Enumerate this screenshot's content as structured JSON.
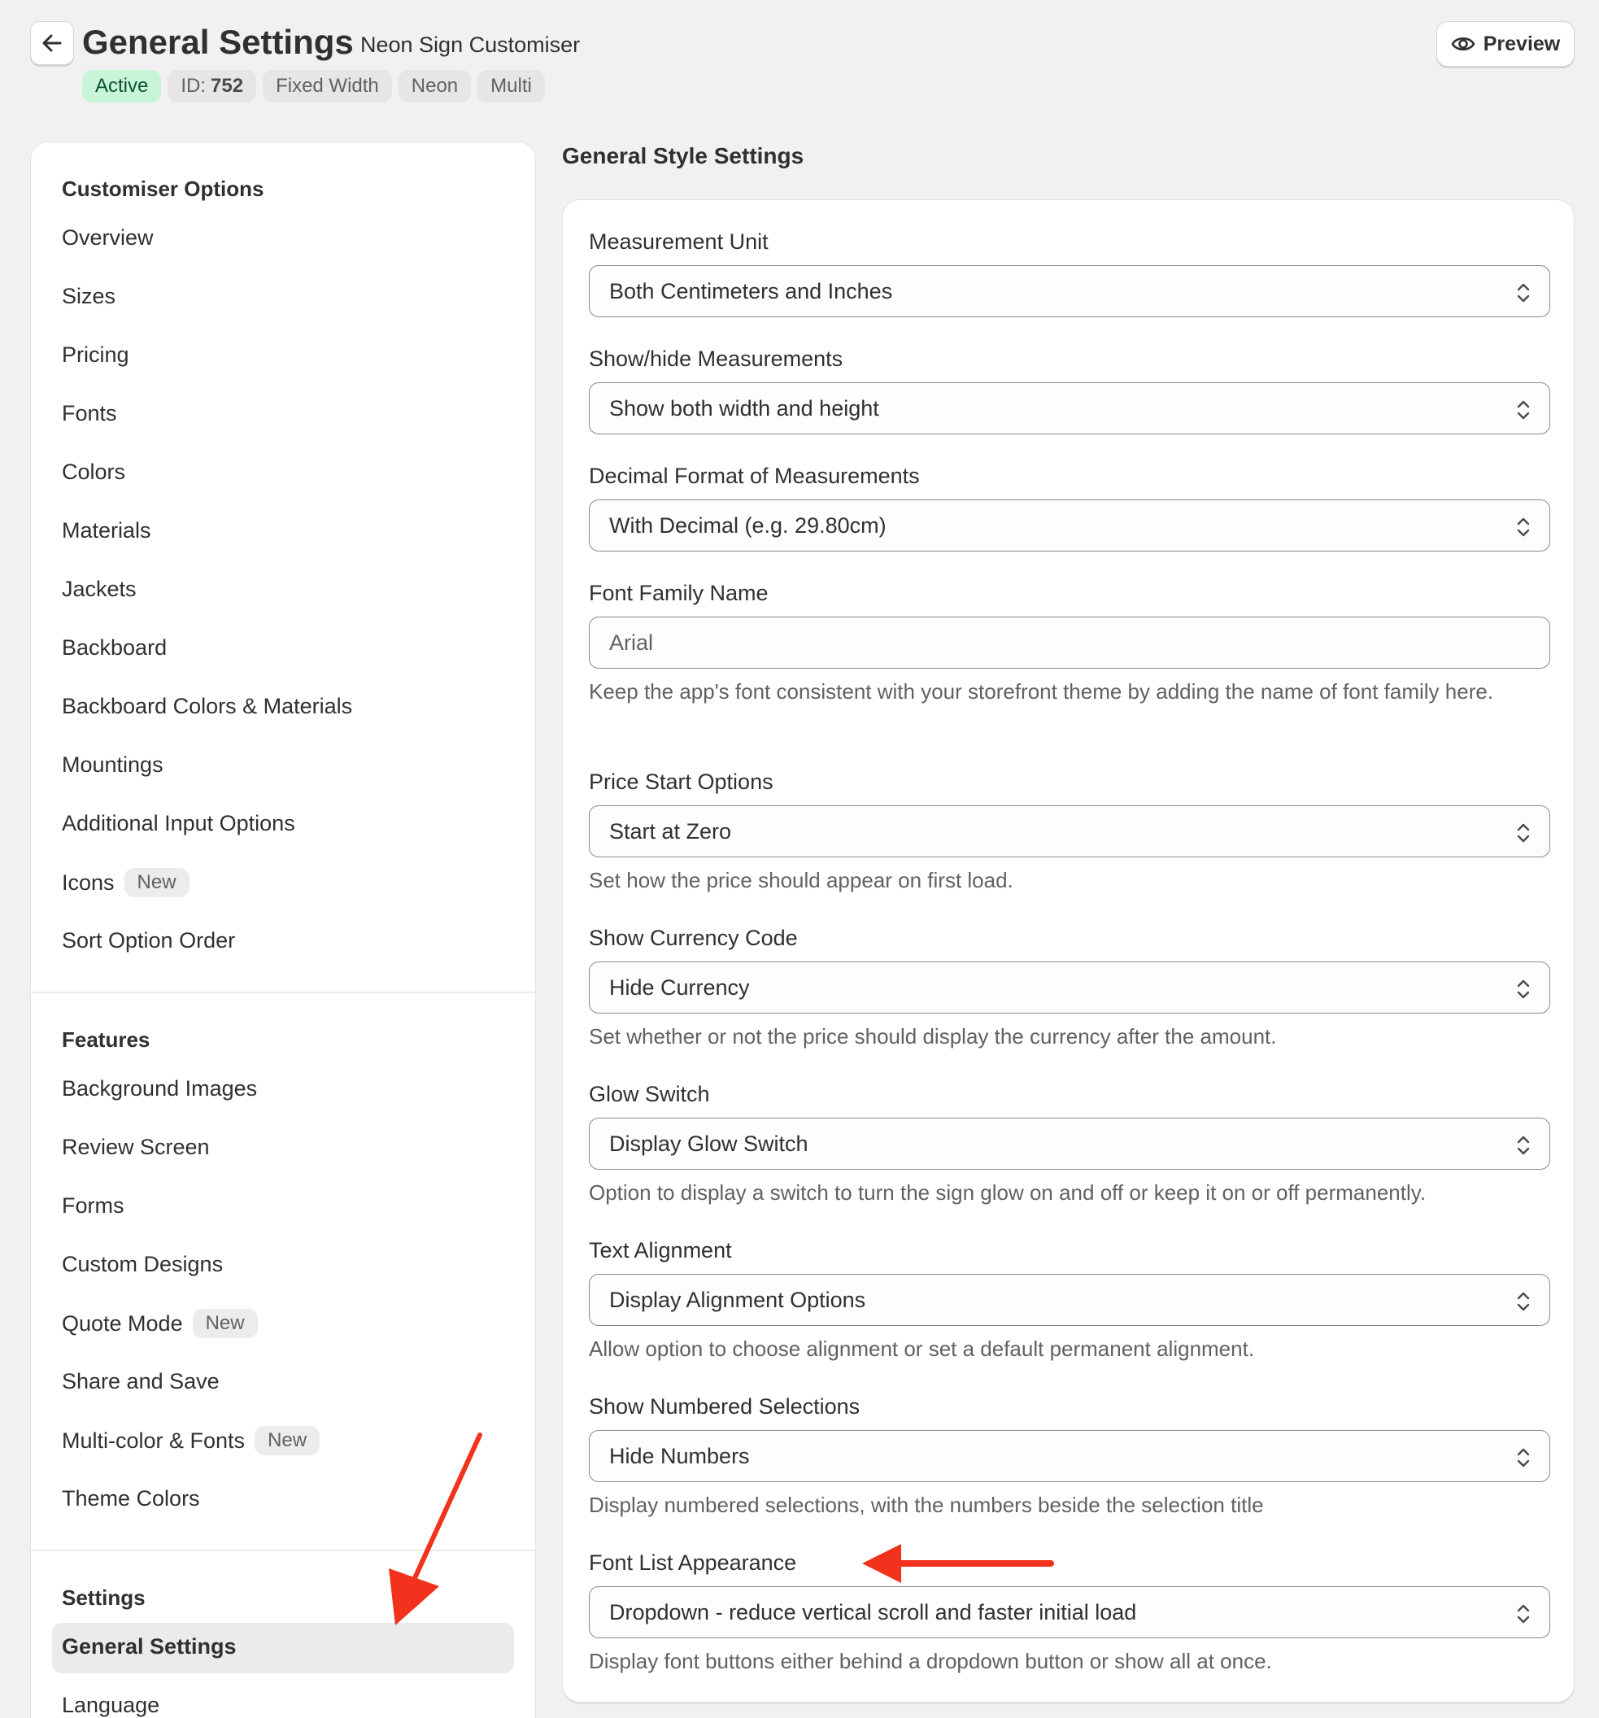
{
  "header": {
    "title": "General Settings",
    "subtitle": "Neon Sign Customiser",
    "badges": {
      "active": "Active",
      "id_prefix": "ID:",
      "id_value": "752",
      "fixed_width": "Fixed Width",
      "neon": "Neon",
      "multi": "Multi"
    },
    "preview_label": "Preview"
  },
  "sidebar": {
    "customiser_heading": "Customiser Options",
    "customiser_items": [
      {
        "label": "Overview"
      },
      {
        "label": "Sizes"
      },
      {
        "label": "Pricing"
      },
      {
        "label": "Fonts"
      },
      {
        "label": "Colors"
      },
      {
        "label": "Materials"
      },
      {
        "label": "Jackets"
      },
      {
        "label": "Backboard"
      },
      {
        "label": "Backboard Colors & Materials"
      },
      {
        "label": "Mountings"
      },
      {
        "label": "Additional Input Options"
      },
      {
        "label": "Icons",
        "badge": "New"
      },
      {
        "label": "Sort Option Order"
      }
    ],
    "features_heading": "Features",
    "features_items": [
      {
        "label": "Background Images"
      },
      {
        "label": "Review Screen"
      },
      {
        "label": "Forms"
      },
      {
        "label": "Custom Designs"
      },
      {
        "label": "Quote Mode",
        "badge": "New"
      },
      {
        "label": "Share and Save"
      },
      {
        "label": "Multi-color & Fonts",
        "badge": "New"
      },
      {
        "label": "Theme Colors"
      }
    ],
    "settings_heading": "Settings",
    "settings_items": [
      {
        "label": "General Settings"
      },
      {
        "label": "Language"
      }
    ]
  },
  "main": {
    "title": "General Style Settings",
    "fields": [
      {
        "label": "Measurement Unit",
        "value": "Both Centimeters and Inches",
        "help": ""
      },
      {
        "label": "Show/hide Measurements",
        "value": "Show both width and height",
        "help": ""
      },
      {
        "label": "Decimal Format of Measurements",
        "value": "With Decimal (e.g. 29.80cm)",
        "help": ""
      },
      {
        "label": "Font Family Name",
        "value": "Arial",
        "help": "Keep the app's font consistent with your storefront theme by adding the name of font family here."
      },
      {
        "label": "Price Start Options",
        "value": "Start at Zero",
        "help": "Set how the price should appear on first load."
      },
      {
        "label": "Show Currency Code",
        "value": "Hide Currency",
        "help": "Set whether or not the price should display the currency after the amount."
      },
      {
        "label": "Glow Switch",
        "value": "Display Glow Switch",
        "help": "Option to display a switch to turn the sign glow on and off or keep it on or off permanently."
      },
      {
        "label": "Text Alignment",
        "value": "Display Alignment Options",
        "help": "Allow option to choose alignment or set a default permanent alignment."
      },
      {
        "label": "Show Numbered Selections",
        "value": "Hide Numbers",
        "help": "Display numbered selections, with the numbers beside the selection title"
      },
      {
        "label": "Font List Appearance",
        "value": "Dropdown - reduce vertical scroll and faster initial load",
        "help": "Display font buttons either behind a dropdown button or show all at once."
      }
    ]
  },
  "colors": {
    "annotation_arrow": "#f2321c",
    "active_badge_bg": "#c8f5d8",
    "active_badge_text": "#0c5132"
  },
  "icons": {
    "back": "arrow-left-icon",
    "preview": "eye-icon",
    "select": "chevron-up-down-icon"
  }
}
